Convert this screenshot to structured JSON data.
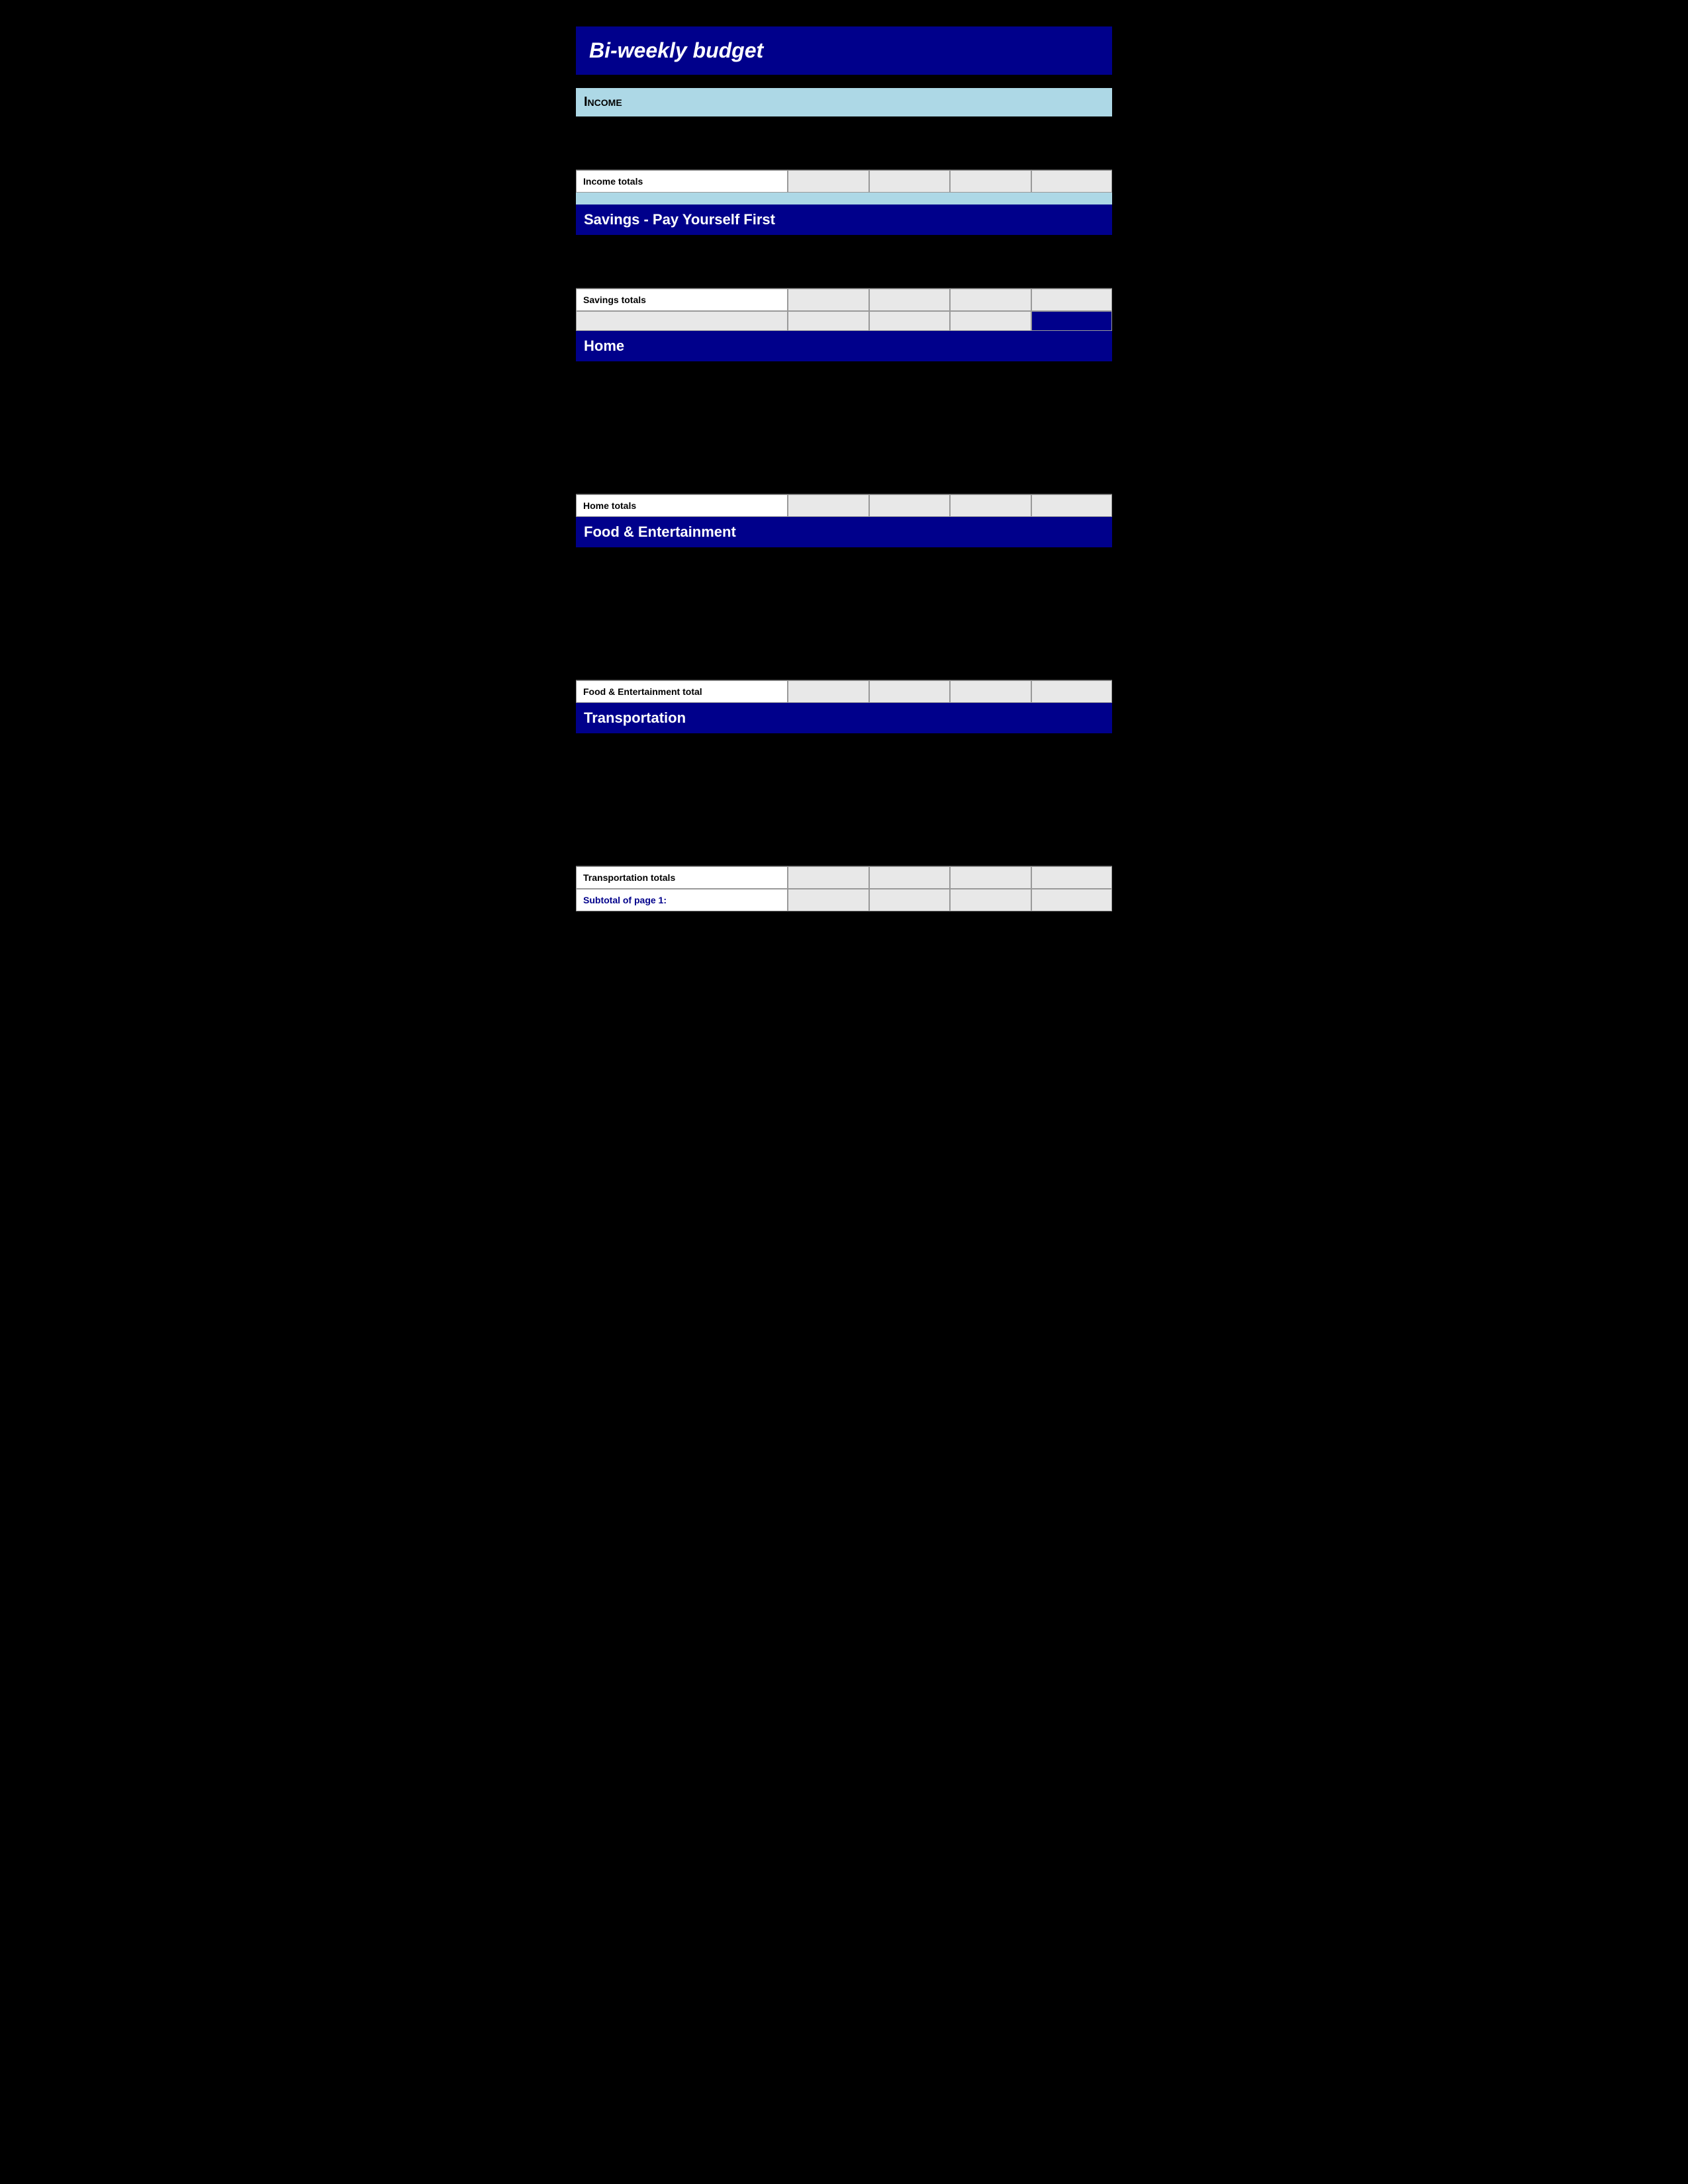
{
  "page": {
    "title": "Bi-weekly  budget"
  },
  "sections": {
    "income": {
      "label": "Income",
      "totals_label": "Income totals"
    },
    "savings": {
      "label": "Savings - Pay Yourself First",
      "totals_label": "Savings totals"
    },
    "home": {
      "label": "Home",
      "totals_label": "Home totals"
    },
    "food": {
      "label": "Food & Entertainment",
      "totals_label": "Food & Entertainment total"
    },
    "transportation": {
      "label": "Transportation",
      "totals_label": "Transportation totals"
    },
    "subtotal": {
      "label": "Subtotal of page 1:"
    }
  }
}
